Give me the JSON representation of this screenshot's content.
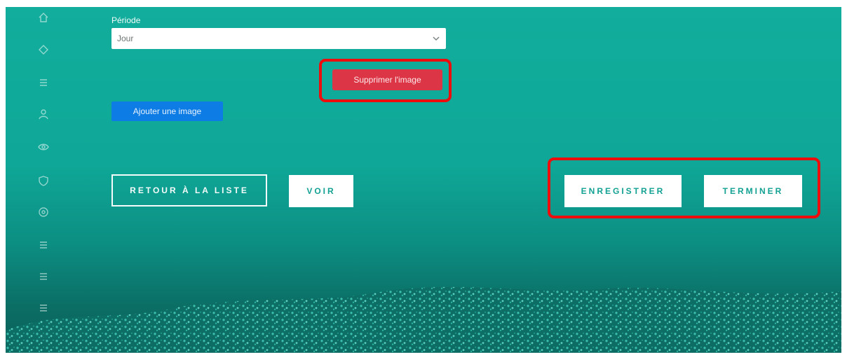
{
  "form": {
    "period_label": "Période",
    "period_value": "Jour"
  },
  "buttons": {
    "delete_image": "Supprimer l'image",
    "add_image": "Ajouter une image",
    "back_to_list": "RETOUR À LA LISTE",
    "view": "VOIR",
    "save": "ENREGISTRER",
    "finish": "TERMINER"
  },
  "sidebar": {
    "icons": [
      "home-icon",
      "diamond-icon",
      "list-icon",
      "user-icon",
      "visibility-icon",
      "shield-icon",
      "target-icon",
      "list-icon",
      "list-icon",
      "list-icon",
      "list-icon"
    ]
  },
  "colors": {
    "background": "#12ad9c",
    "delete_button": "#dc3545",
    "add_button": "#0d7ce4",
    "highlight": "#ee0d0d",
    "action_text": "#12a193"
  }
}
